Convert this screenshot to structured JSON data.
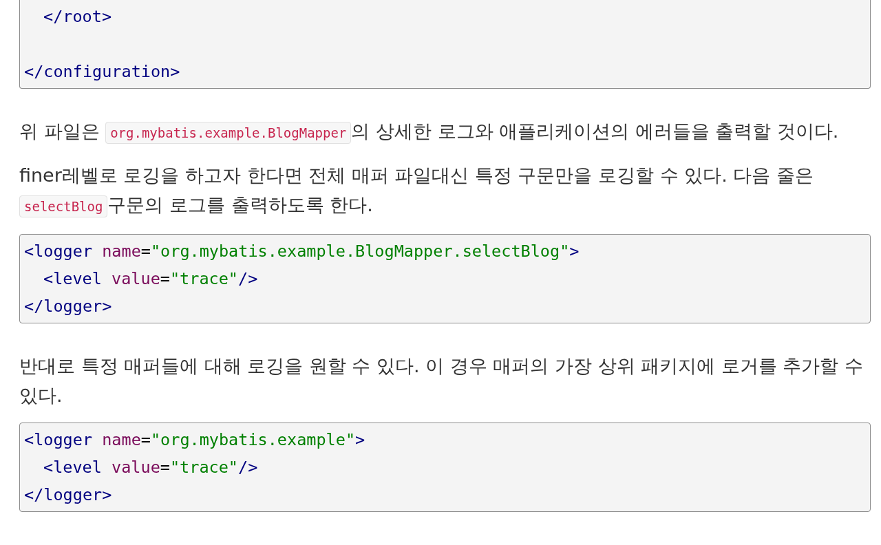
{
  "blocks": [
    {
      "kind": "code",
      "lines": [
        {
          "kind": "code",
          "indent": true,
          "tokens": [
            {
              "kind": "tag",
              "text": "</root>"
            }
          ]
        },
        {
          "kind": "blank"
        },
        {
          "kind": "code",
          "indent": false,
          "tokens": [
            {
              "kind": "tag",
              "text": "</configuration>"
            }
          ]
        }
      ]
    },
    {
      "kind": "paragraph",
      "parts": [
        {
          "kind": "text",
          "text": "위 파일은 "
        },
        {
          "kind": "code",
          "text": "org.mybatis.example.BlogMapper"
        },
        {
          "kind": "text",
          "text": "의 상세한 로그와 애플리케이션의 에러들을 출력할 것이다."
        }
      ]
    },
    {
      "kind": "paragraph",
      "parts": [
        {
          "kind": "text",
          "text": "finer레벨로 로깅을 하고자 한다면 전체 매퍼 파일대신 특정 구문만을 로깅할 수 있다. 다음 줄은 "
        },
        {
          "kind": "code",
          "text": "selectBlog"
        },
        {
          "kind": "text",
          "text": "구문의 로그를 출력하도록 한다."
        }
      ]
    },
    {
      "kind": "code",
      "lines": [
        {
          "kind": "code",
          "indent": false,
          "tokens": [
            {
              "kind": "tag",
              "text": "<logger "
            },
            {
              "kind": "attr",
              "text": "name"
            },
            {
              "kind": "plain",
              "text": "="
            },
            {
              "kind": "value",
              "text": "\"org.mybatis.example.BlogMapper.selectBlog\""
            },
            {
              "kind": "tag",
              "text": ">"
            }
          ]
        },
        {
          "kind": "code",
          "indent": true,
          "tokens": [
            {
              "kind": "tag",
              "text": "<level "
            },
            {
              "kind": "attr",
              "text": "value"
            },
            {
              "kind": "plain",
              "text": "="
            },
            {
              "kind": "value",
              "text": "\"trace\""
            },
            {
              "kind": "tag",
              "text": "/>"
            }
          ]
        },
        {
          "kind": "code",
          "indent": false,
          "tokens": [
            {
              "kind": "tag",
              "text": "</logger>"
            }
          ]
        }
      ]
    },
    {
      "kind": "paragraph",
      "parts": [
        {
          "kind": "text",
          "text": "반대로 특정 매퍼들에 대해 로깅을 원할 수 있다. 이 경우 매퍼의 가장 상위 패키지에 로거를 추가할 수 있다."
        }
      ]
    },
    {
      "kind": "code",
      "lines": [
        {
          "kind": "code",
          "indent": false,
          "tokens": [
            {
              "kind": "tag",
              "text": "<logger "
            },
            {
              "kind": "attr",
              "text": "name"
            },
            {
              "kind": "plain",
              "text": "="
            },
            {
              "kind": "value",
              "text": "\"org.mybatis.example\""
            },
            {
              "kind": "tag",
              "text": ">"
            }
          ]
        },
        {
          "kind": "code",
          "indent": true,
          "tokens": [
            {
              "kind": "tag",
              "text": "<level "
            },
            {
              "kind": "attr",
              "text": "value"
            },
            {
              "kind": "plain",
              "text": "="
            },
            {
              "kind": "value",
              "text": "\"trace\""
            },
            {
              "kind": "tag",
              "text": "/>"
            }
          ]
        },
        {
          "kind": "code",
          "indent": false,
          "tokens": [
            {
              "kind": "tag",
              "text": "</logger>"
            }
          ]
        }
      ]
    }
  ]
}
